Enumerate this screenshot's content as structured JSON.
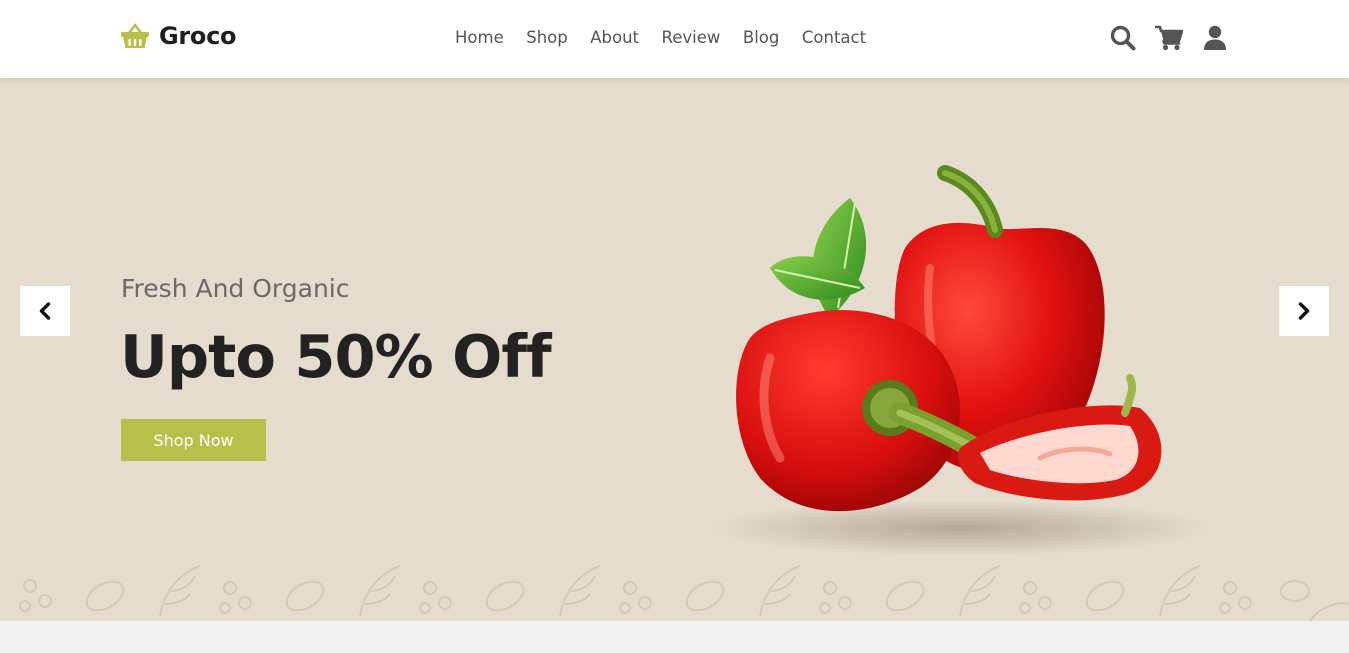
{
  "brand": {
    "name": "Groco",
    "icon": "shopping-basket-icon",
    "accent": "#b7c04a"
  },
  "nav": {
    "items": [
      {
        "label": "Home"
      },
      {
        "label": "Shop"
      },
      {
        "label": "About"
      },
      {
        "label": "Review"
      },
      {
        "label": "Blog"
      },
      {
        "label": "Contact"
      }
    ]
  },
  "header_icons": [
    "search-icon",
    "cart-icon",
    "user-icon"
  ],
  "hero": {
    "subtitle": "Fresh And Organic",
    "headline": "Upto 50% Off",
    "cta_label": "Shop Now",
    "background": "#e6dccd",
    "image": "red-bell-peppers"
  },
  "slider": {
    "prev_icon": "chevron-left-icon",
    "next_icon": "chevron-right-icon"
  }
}
